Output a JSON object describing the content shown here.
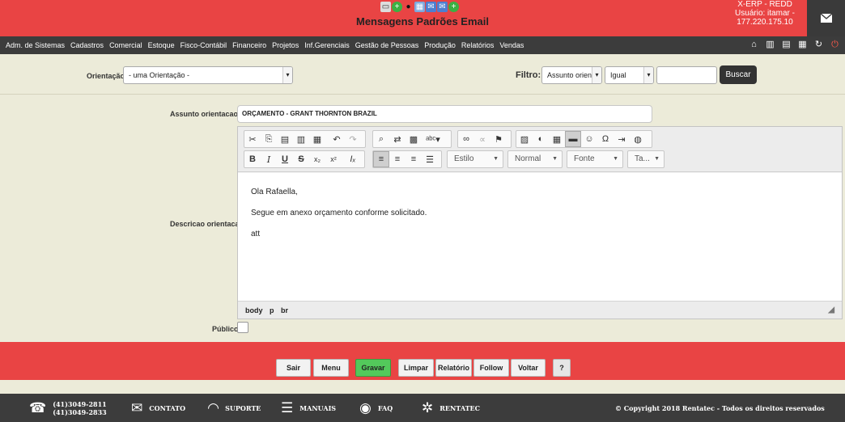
{
  "header": {
    "title": "Mensagens Padrões Email",
    "system_line1": "X-ERP - REDD",
    "system_line2": "Usuário: itamar -",
    "system_line3": "177.220.175.10",
    "mail_icon": "envelope-icon"
  },
  "menu": {
    "items": [
      "Adm. de Sistemas",
      "Cadastros",
      "Comercial",
      "Estoque",
      "Fisco-Contábil",
      "Financeiro",
      "Projetos",
      "Inf.Gerenciais",
      "Gestão de Pessoas",
      "Produção",
      "Relatórios",
      "Vendas"
    ]
  },
  "filter": {
    "orientacao_label": "Orientação",
    "orientacao_value": "- uma Orientação -",
    "filtro_label": "Filtro:",
    "campo_value": "Assunto orient",
    "operador_value": "Igual",
    "valor_value": "",
    "buscar_label": "Buscar"
  },
  "form": {
    "assunto_label": "Assunto orientacao",
    "assunto_required": "*",
    "assunto_value": "ORÇAMENTO - GRANT THORNTON BRAZIL",
    "descricao_label": "Descricao orientacao",
    "publico_label": "Público"
  },
  "editor": {
    "estilo": "Estilo",
    "formato": "Normal",
    "fonte": "Fonte",
    "tamanho": "Ta...",
    "body_lines": [
      "Ola Rafaella,",
      "Segue em anexo orçamento conforme solicitado.",
      "att"
    ],
    "path": [
      "body",
      "p",
      "br"
    ]
  },
  "actions": {
    "sair": "Sair",
    "menu": "Menu",
    "gravar": "Gravar",
    "limpar": "Limpar",
    "relatorio": "Relatório",
    "follow_up": "Follow Up",
    "voltar": "Voltar",
    "help": "?"
  },
  "footer": {
    "phone1": "(41)3049-2811",
    "phone2": "(41)3049-2833",
    "contato": "CONTATO",
    "suporte": "SUPORTE",
    "manuais": "MANUAIS",
    "faq": "FAQ",
    "rentatec": "RENTATEC",
    "copyright": "© Copyright 2018 Rentatec - Todos os direitos reservados"
  },
  "colors": {
    "header_red": "#e94444",
    "menu_dark": "#3c3c3c",
    "form_bg": "#ecebd9",
    "save_green": "#53c95b"
  }
}
